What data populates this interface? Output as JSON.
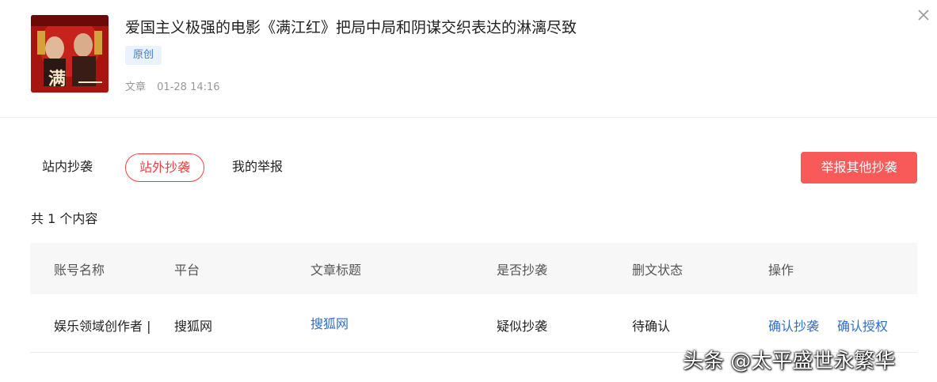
{
  "article": {
    "title": "爱国主义极强的电影《满江红》把局中局和阴谋交织表达的淋漓尽致",
    "badge": "原创",
    "type": "文章",
    "time": "01-28 14:16"
  },
  "tabs": [
    "站内抄袭",
    "站外抄袭",
    "我的举报"
  ],
  "report_button": "举报其他抄袭",
  "count_text": "共 1 个内容",
  "table": {
    "headers": [
      "账号名称",
      "平台",
      "文章标题",
      "是否抄袭",
      "删文状态",
      "操作"
    ],
    "rows": [
      {
        "account": "娱乐领域创作者 |",
        "platform": "搜狐网",
        "title": "搜狐网",
        "plagiarism": "疑似抄袭",
        "status": "待确认",
        "actions": [
          "确认抄袭",
          "确认授权"
        ]
      }
    ]
  },
  "watermark": "头条 @太平盛世永繁华",
  "colors": {
    "accent_red": "#f04142",
    "button_red": "#f85959",
    "link_blue": "#2f6ec8",
    "badge_bg": "#eaf2fd"
  }
}
